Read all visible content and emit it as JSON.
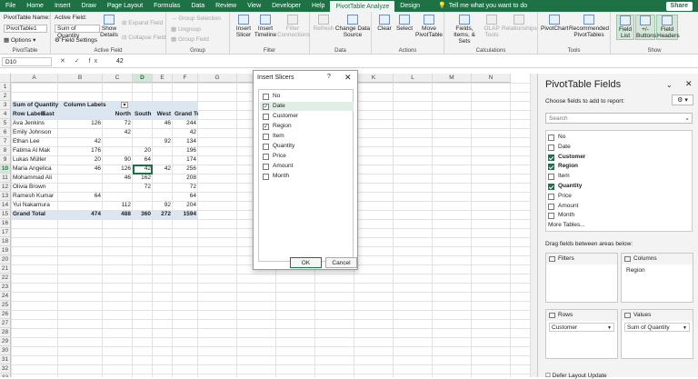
{
  "menu": {
    "items": [
      "File",
      "Home",
      "Insert",
      "Draw",
      "Page Layout",
      "Formulas",
      "Data",
      "Review",
      "View",
      "Developer",
      "Help",
      "PivotTable Analyze",
      "Design"
    ],
    "active": "PivotTable Analyze",
    "tell_me": "Tell me what you want to do",
    "share": "Share"
  },
  "ribbon": {
    "pt_name_label": "PivotTable Name:",
    "pt_name_value": "PivotTable1",
    "options": "Options",
    "active_field_label": "Active Field:",
    "active_field_value": "Sum of Quantity",
    "field_settings": "Field Settings",
    "show_details": "Show Details",
    "expand_field": "Expand Field",
    "collapse_field": "Collapse Field",
    "group_selection": "Group Selection",
    "ungroup": "Ungroup",
    "group_field": "Group Field",
    "insert_slicer": "Insert Slicer",
    "insert_timeline": "Insert Timeline",
    "filter_connections": "Filter Connections",
    "refresh": "Refresh",
    "change_data_source": "Change Data Source",
    "clear": "Clear",
    "select": "Select",
    "move_pivottable": "Move PivotTable",
    "fields_items_sets": "Fields, Items, & Sets",
    "olap_tools": "OLAP Tools",
    "relationships": "Relationships",
    "pivotchart": "PivotChart",
    "recommended": "Recommended PivotTables",
    "field_list": "Field List",
    "buttons": "+/- Buttons",
    "field_headers": "Field Headers",
    "groups": {
      "pivottable": "PivotTable",
      "active_field": "Active Field",
      "group": "Group",
      "filter": "Filter",
      "data": "Data",
      "actions": "Actions",
      "calculations": "Calculations",
      "tools": "Tools",
      "show": "Show"
    }
  },
  "formula_bar": {
    "name_box": "D10",
    "fx": "✕ ✓ fx",
    "value": "42"
  },
  "sheet": {
    "columns": [
      "A",
      "B",
      "C",
      "D",
      "E",
      "F",
      "G",
      "H",
      "I",
      "J",
      "K",
      "L",
      "M",
      "N"
    ],
    "rows": [
      "1",
      "2",
      "3",
      "4",
      "5",
      "6",
      "7",
      "8",
      "9",
      "10",
      "11",
      "12",
      "13",
      "14",
      "15",
      "16",
      "17",
      "18",
      "19",
      "20",
      "21",
      "22",
      "23",
      "24",
      "25",
      "26",
      "27",
      "28",
      "29",
      "30",
      "31",
      "32",
      "33"
    ],
    "selected_cell": "D10",
    "pivot": {
      "header_sum": "Sum of Quantity",
      "header_col_labels": "Column Labels",
      "row_labels": "Row Labels",
      "col_values": [
        "East",
        "North",
        "South",
        "West",
        "Grand Total"
      ],
      "rows": [
        {
          "name": "Ava Jenkins",
          "east": "126",
          "north": "72",
          "south": "",
          "west": "46",
          "total": "244"
        },
        {
          "name": "Emily Johnson",
          "east": "",
          "north": "42",
          "south": "",
          "west": "",
          "total": "42"
        },
        {
          "name": "Ethan Lee",
          "east": "42",
          "north": "",
          "south": "",
          "west": "92",
          "total": "134"
        },
        {
          "name": "Fatima Al Mak",
          "east": "176",
          "north": "",
          "south": "20",
          "west": "",
          "total": "196"
        },
        {
          "name": "Lukas Müller",
          "east": "20",
          "north": "90",
          "south": "64",
          "west": "",
          "total": "174"
        },
        {
          "name": "Maria Angelica",
          "east": "46",
          "north": "126",
          "south": "42",
          "west": "42",
          "total": "256"
        },
        {
          "name": "Mohammad Ali",
          "east": "",
          "north": "46",
          "south": "162",
          "west": "",
          "total": "208"
        },
        {
          "name": "Olivia Brown",
          "east": "",
          "north": "",
          "south": "72",
          "west": "",
          "total": "72"
        },
        {
          "name": "Ramesh Kumar",
          "east": "64",
          "north": "",
          "south": "",
          "west": "",
          "total": "64"
        },
        {
          "name": "Yui Nakamura",
          "east": "",
          "north": "112",
          "south": "",
          "west": "92",
          "total": "204"
        }
      ],
      "grand_total": {
        "name": "Grand Total",
        "east": "474",
        "north": "488",
        "south": "360",
        "west": "272",
        "total": "1594"
      }
    }
  },
  "slicer_dialog": {
    "title": "Insert Slicers",
    "help": "?",
    "close": "✕",
    "fields": [
      {
        "label": "No",
        "checked": false
      },
      {
        "label": "Date",
        "checked": true
      },
      {
        "label": "Customer",
        "checked": false
      },
      {
        "label": "Region",
        "checked": true
      },
      {
        "label": "Item",
        "checked": false
      },
      {
        "label": "Quantity",
        "checked": false
      },
      {
        "label": "Price",
        "checked": false
      },
      {
        "label": "Amount",
        "checked": false
      },
      {
        "label": "Month",
        "checked": false
      }
    ],
    "ok": "OK",
    "cancel": "Cancel"
  },
  "field_pane": {
    "title": "PivotTable Fields",
    "subtitle": "Choose fields to add to report:",
    "search_placeholder": "Search",
    "fields": [
      {
        "label": "No",
        "checked": false
      },
      {
        "label": "Date",
        "checked": false
      },
      {
        "label": "Customer",
        "checked": true
      },
      {
        "label": "Region",
        "checked": true
      },
      {
        "label": "Item",
        "checked": false
      },
      {
        "label": "Quantity",
        "checked": true
      },
      {
        "label": "Price",
        "checked": false
      },
      {
        "label": "Amount",
        "checked": false
      },
      {
        "label": "Month",
        "checked": false
      }
    ],
    "more_tables": "More Tables...",
    "drag_text": "Drag fields between areas below:",
    "filters": "Filters",
    "columns": "Columns",
    "columns_item": "Region",
    "rows": "Rows",
    "rows_item": "Customer",
    "values": "Values",
    "values_item": "Sum of Quantity",
    "defer": "Defer Layout Update"
  }
}
